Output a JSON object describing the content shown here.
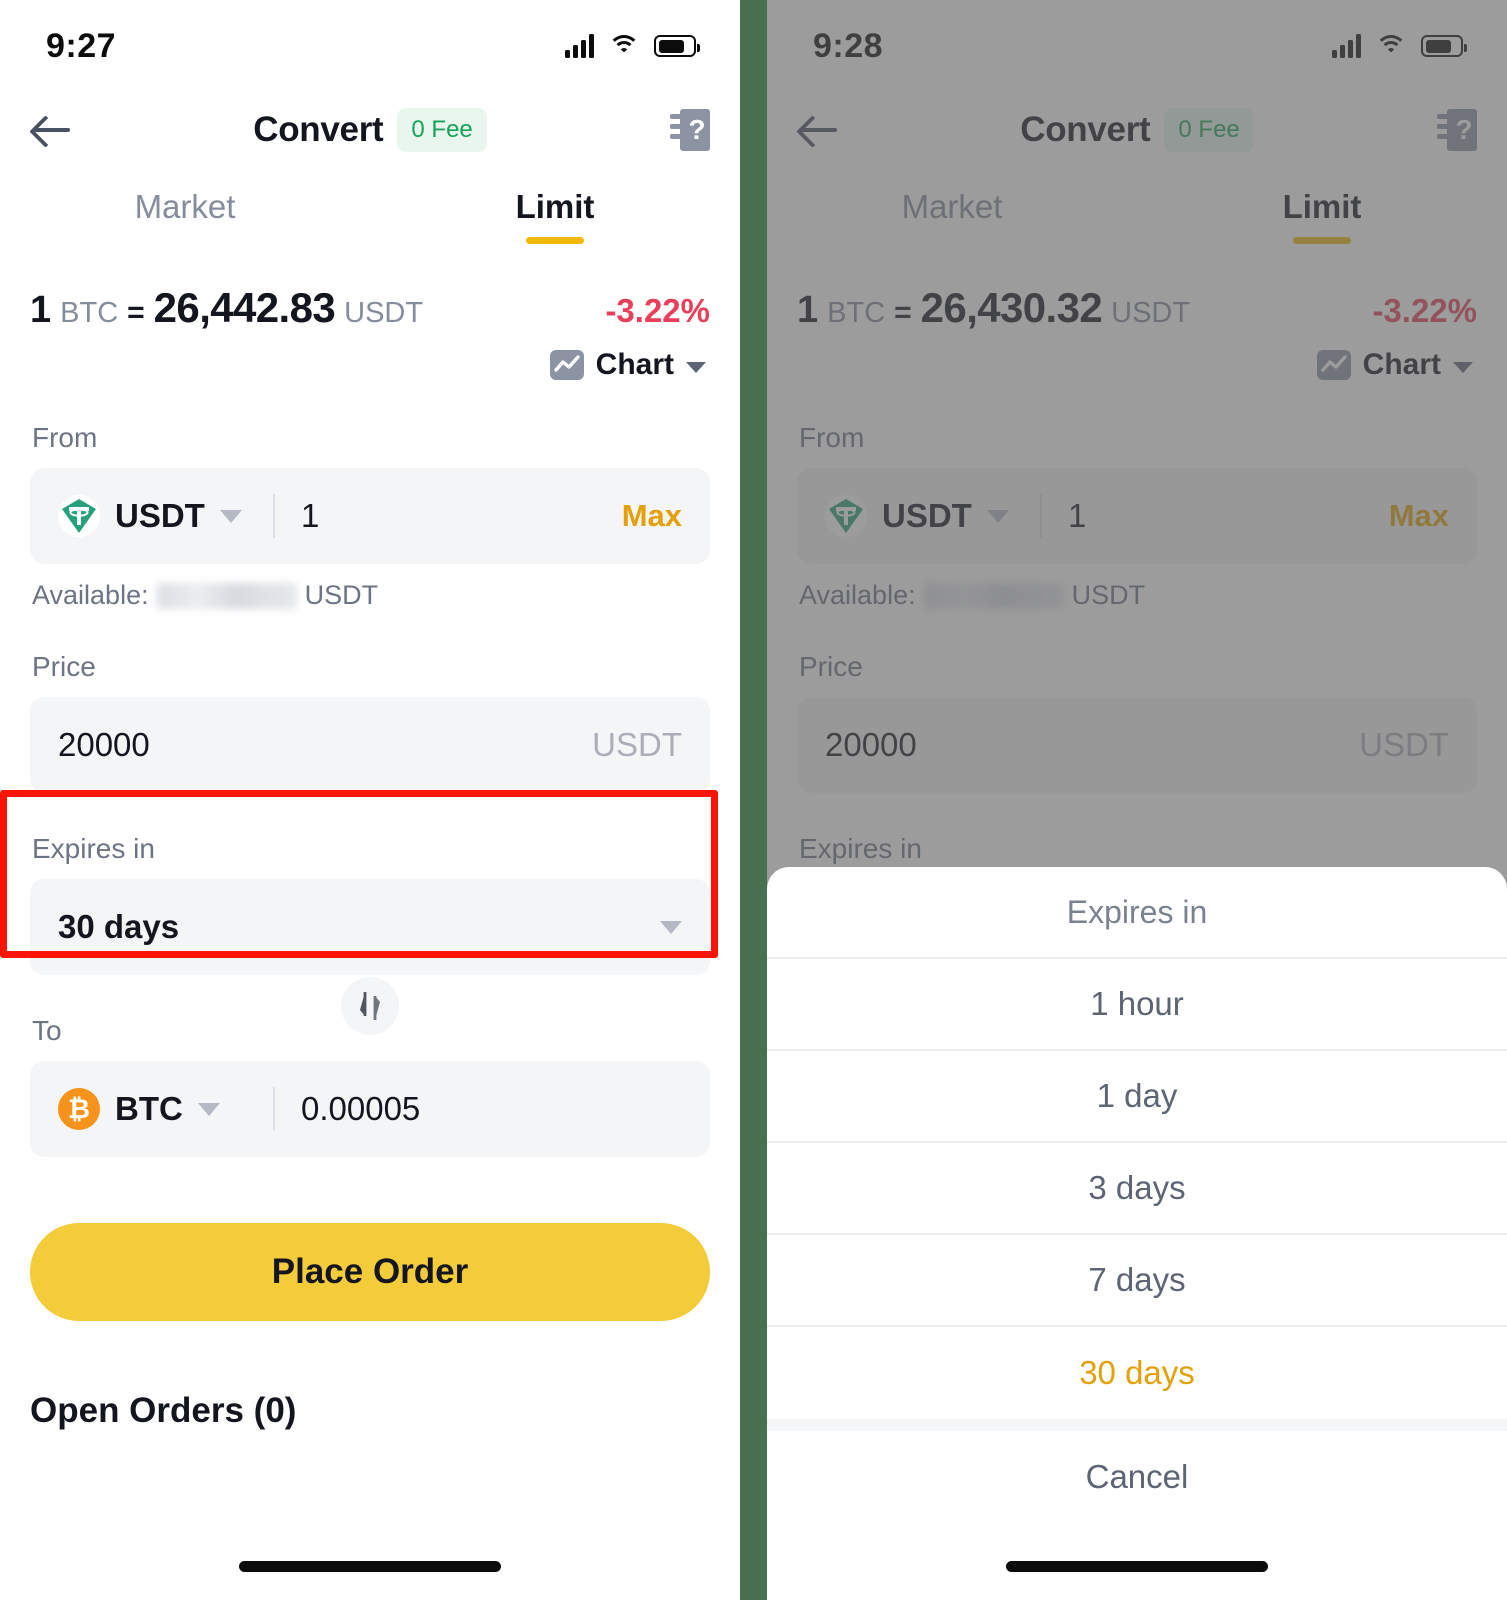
{
  "left": {
    "status": {
      "time": "9:27",
      "signal_icon": "cellular-signal-icon",
      "wifi_icon": "wifi-icon",
      "battery_icon": "battery-icon"
    },
    "nav": {
      "back_icon": "back-arrow-icon",
      "title": "Convert",
      "fee_badge": "0 Fee",
      "help_icon": "help-guide-icon"
    },
    "tabs": [
      {
        "label": "Market",
        "active": false
      },
      {
        "label": "Limit",
        "active": true
      }
    ],
    "rate": {
      "amount": "1",
      "base": "BTC",
      "equals": "=",
      "value": "26,442.83",
      "quote": "USDT",
      "change": "-3.22%"
    },
    "chart_toggle": {
      "label": "Chart",
      "icon": "line-chart-icon",
      "chevron": "chevron-down-icon"
    },
    "from": {
      "label": "From",
      "coin": "USDT",
      "coin_icon": "usdt-icon",
      "amount": "1",
      "max_label": "Max",
      "available_prefix": "Available:",
      "available_suffix": "USDT"
    },
    "price": {
      "label": "Price",
      "value": "20000",
      "unit": "USDT"
    },
    "expires": {
      "label": "Expires in",
      "value": "30 days",
      "chevron": "chevron-down-icon"
    },
    "swap": {
      "icon": "swap-vertical-icon"
    },
    "to": {
      "label": "To",
      "coin": "BTC",
      "coin_icon": "btc-icon",
      "amount": "0.00005"
    },
    "place_order_label": "Place Order",
    "open_orders_label": "Open Orders (0)"
  },
  "right": {
    "status": {
      "time": "9:28",
      "signal_icon": "cellular-signal-icon",
      "wifi_icon": "wifi-icon",
      "battery_icon": "battery-icon"
    },
    "nav": {
      "back_icon": "back-arrow-icon",
      "title": "Convert",
      "fee_badge": "0 Fee",
      "help_icon": "help-guide-icon"
    },
    "tabs": [
      {
        "label": "Market",
        "active": false
      },
      {
        "label": "Limit",
        "active": true
      }
    ],
    "rate": {
      "amount": "1",
      "base": "BTC",
      "equals": "=",
      "value": "26,430.32",
      "quote": "USDT",
      "change": "-3.22%"
    },
    "chart_toggle": {
      "label": "Chart",
      "icon": "line-chart-icon",
      "chevron": "chevron-down-icon"
    },
    "from": {
      "label": "From",
      "coin": "USDT",
      "coin_icon": "usdt-icon",
      "amount": "1",
      "max_label": "Max",
      "available_prefix": "Available:",
      "available_suffix": "USDT"
    },
    "price": {
      "label": "Price",
      "value": "20000",
      "unit": "USDT"
    },
    "expires": {
      "label": "Expires in"
    },
    "sheet": {
      "title": "Expires in",
      "options": [
        {
          "label": "1 hour",
          "selected": false
        },
        {
          "label": "1 day",
          "selected": false
        },
        {
          "label": "3 days",
          "selected": false
        },
        {
          "label": "7 days",
          "selected": false
        },
        {
          "label": "30 days",
          "selected": true
        }
      ],
      "cancel_label": "Cancel"
    }
  },
  "annotation": {
    "highlight_color": "#fb1505",
    "target": "expires-in-field"
  },
  "colors": {
    "brand_yellow": "#f0b90b",
    "button_yellow": "#f4cc3a",
    "accent_amber": "#e3a008",
    "negative_red": "#e8405a",
    "fee_green": "#18a35a",
    "usdt_green": "#26a17b",
    "btc_orange": "#f7931a",
    "divider_green": "#4a7052",
    "text_primary": "#14161f",
    "text_muted": "#6d7484",
    "field_bg": "#f4f5f7"
  }
}
